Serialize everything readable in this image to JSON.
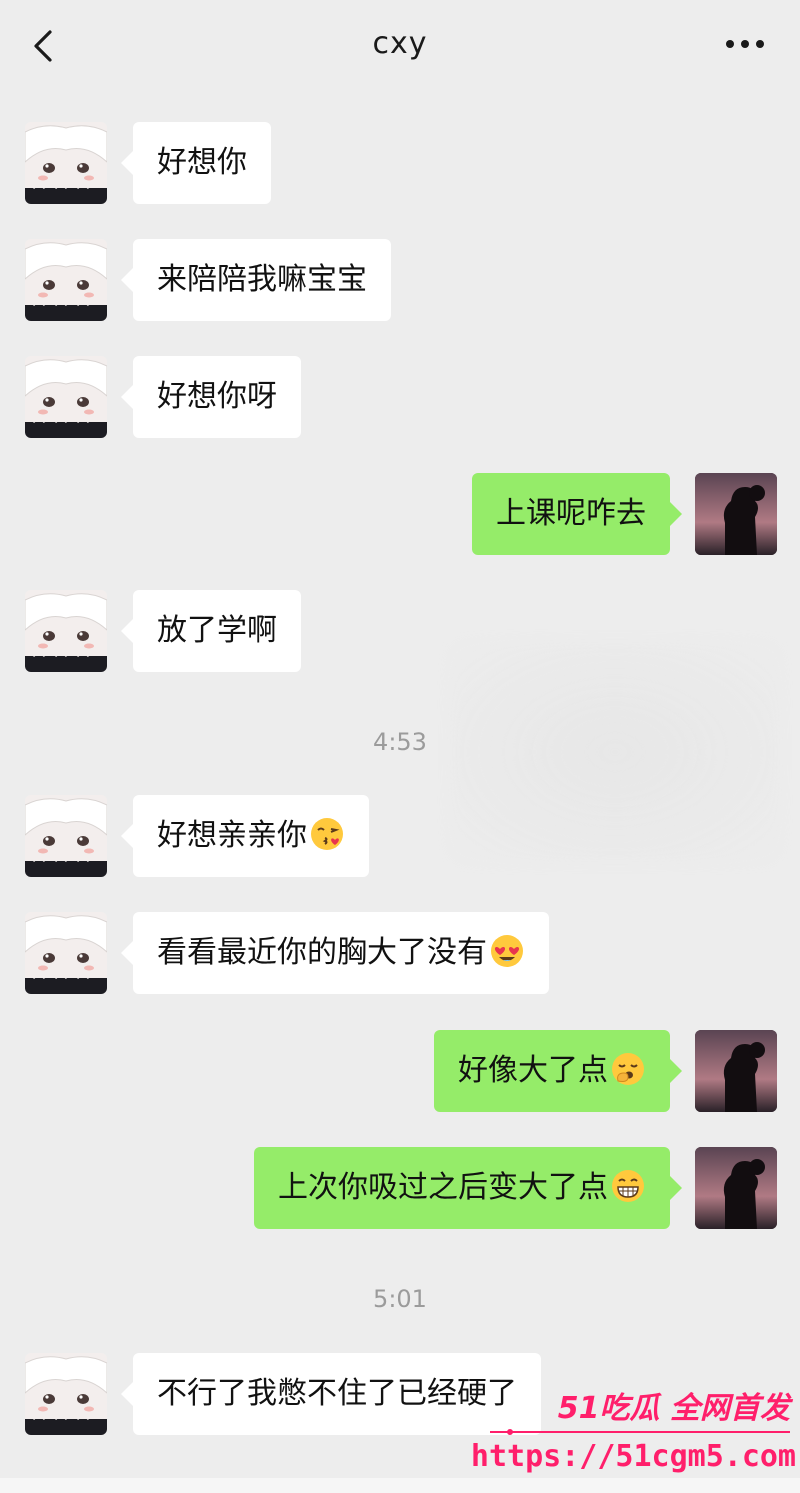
{
  "header": {
    "title": "cxy"
  },
  "messages": [
    {
      "side": "in",
      "text": "好想你"
    },
    {
      "side": "in",
      "text": "来陪陪我嘛宝宝"
    },
    {
      "side": "in",
      "text": "好想你呀"
    },
    {
      "side": "out",
      "text": "上课呢咋去"
    },
    {
      "side": "in",
      "text": "放了学啊"
    },
    {
      "timestamp": "4:53"
    },
    {
      "side": "in",
      "text": "好想亲亲你",
      "emoji": "kissing-face-emoji"
    },
    {
      "side": "in",
      "text": "看看最近你的胸大了没有",
      "emoji": "heart-eyes-emoji"
    },
    {
      "side": "out",
      "text": "好像大了点",
      "emoji": "yawning-face-emoji"
    },
    {
      "side": "out",
      "text": "上次你吸过之后变大了点",
      "emoji": "grinning-face-emoji"
    },
    {
      "timestamp": "5:01"
    },
    {
      "side": "in",
      "text": "不行了我憋不住了已经硬了"
    }
  ],
  "watermark": {
    "line1": "51吃瓜 全网首发",
    "url": "https://51cgm5.com"
  },
  "colors": {
    "background": "#ededed",
    "incoming": "#ffffff",
    "outgoing": "#95ec69",
    "watermark": "#ff1f6b"
  }
}
